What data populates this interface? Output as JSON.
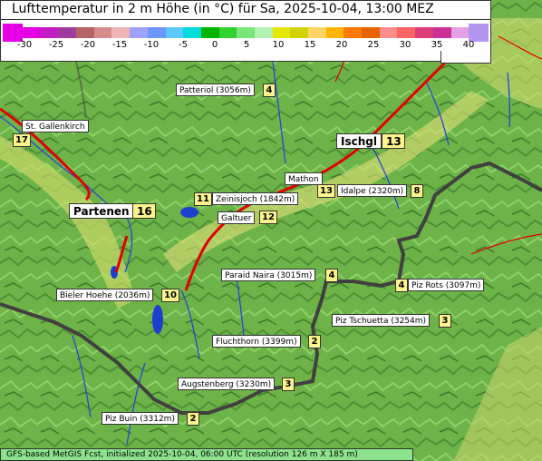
{
  "title": "Lufttemperatur in 2 m Höhe (in °C) für Sa, 2025-10-04, 13:00 MEZ",
  "legend": {
    "ticks": [
      "-30",
      "-25",
      "-20",
      "-15",
      "-10",
      "-5",
      "0",
      "5",
      "10",
      "15",
      "20",
      "25",
      "30",
      "35",
      "40"
    ],
    "colors": [
      "#e600e6",
      "#c31ec3",
      "#a03ca0",
      "#b46464",
      "#d68c8c",
      "#f0b4b4",
      "#a0a0ff",
      "#6e96ff",
      "#5ac8ff",
      "#00dcdc",
      "#00b400",
      "#32d232",
      "#78e678",
      "#b4f0b4",
      "#e6e600",
      "#d2d200",
      "#ffd264",
      "#ffb400",
      "#ff7800",
      "#e66400",
      "#ff8c8c",
      "#ff6464",
      "#dc3c78",
      "#c83296",
      "#e6a0e6"
    ],
    "low_color": "#e600e6",
    "high_color": "#b496f0"
  },
  "places": [
    {
      "id": "patteriol",
      "name": "Patteriol (3056m)",
      "value": "4"
    },
    {
      "id": "st-gallenkirch",
      "name": "St. Gallenkirch",
      "value": "17"
    },
    {
      "id": "ischgl",
      "name": "Ischgl",
      "value": "13"
    },
    {
      "id": "mathon",
      "name": "Mathon",
      "value": "13"
    },
    {
      "id": "idalpe",
      "name": "Idalpe (2320m)",
      "value": "8"
    },
    {
      "id": "zeinisjoch",
      "name": "Zeinisjoch (1842m)",
      "value": "11"
    },
    {
      "id": "partenen",
      "name": "Partenen",
      "value": "16"
    },
    {
      "id": "galtuer",
      "name": "Galtuer",
      "value": "12"
    },
    {
      "id": "paraid-naira",
      "name": "Paraid Naira (3015m)",
      "value": "4"
    },
    {
      "id": "piz-rots",
      "name": "Piz Rots (3097m)",
      "value": "4"
    },
    {
      "id": "bieler-hoehe",
      "name": "Bieler Hoehe (2036m)",
      "value": "10"
    },
    {
      "id": "piz-tschuetta",
      "name": "Piz Tschuetta (3254m)",
      "value": "3"
    },
    {
      "id": "fluchthorn",
      "name": "Fluchthorn (3399m)",
      "value": "2"
    },
    {
      "id": "augstenberg",
      "name": "Augstenberg (3230m)",
      "value": "3"
    },
    {
      "id": "piz-buin",
      "name": "Piz Buin (3312m)",
      "value": "2"
    }
  ],
  "footer": "GFS-based MetGIS Fcst, initialized 2025-10-04, 06:00 UTC  (resolution 126 m X 185 m)"
}
